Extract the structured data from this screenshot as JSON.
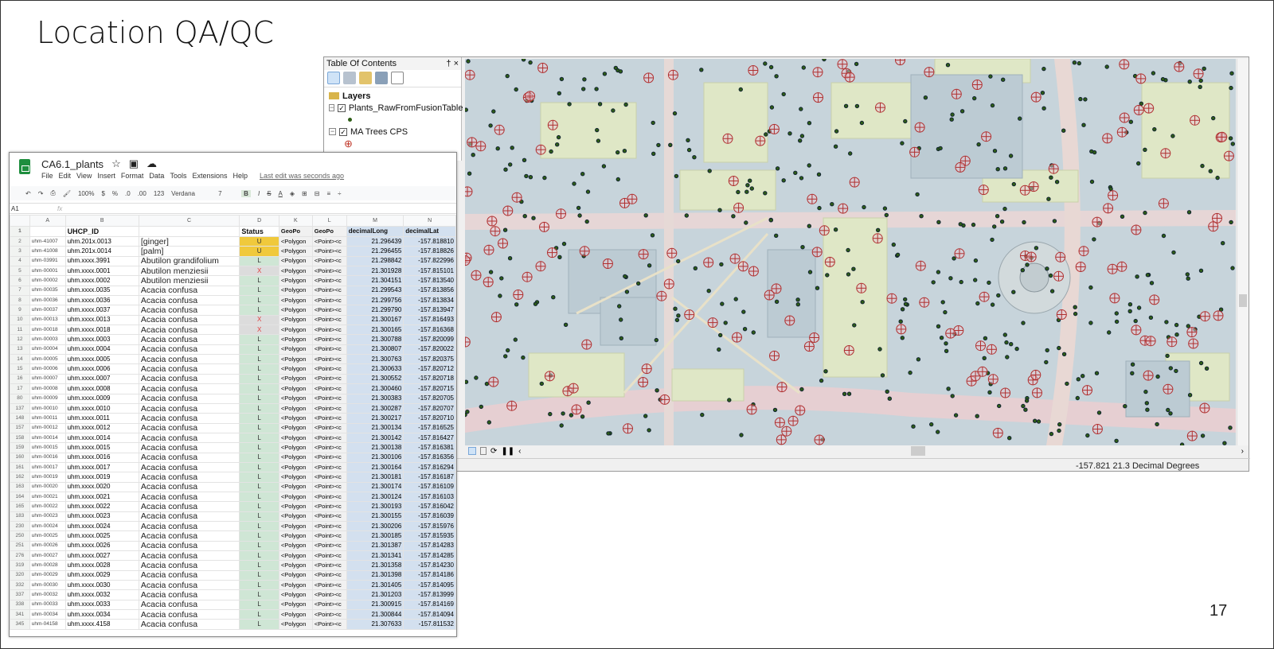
{
  "slide": {
    "title": "Location QA/QC",
    "page_number": "17"
  },
  "arcmap": {
    "toc": {
      "title": "Table Of Contents",
      "pin": "† ×",
      "root": "Layers",
      "layers": [
        {
          "name": "Plants_RawFromFusionTable",
          "checked": true,
          "symbol": "green-dot"
        },
        {
          "name": "MA Trees CPS",
          "checked": true,
          "symbol": "red-circle-cross"
        }
      ]
    },
    "status": {
      "coordinates": "-157.821  21.3 Decimal Degrees"
    },
    "colors": {
      "plant_dot": "#2e5d16",
      "tree_symbol": "#c0392b"
    }
  },
  "sheet": {
    "name": "CA6.1_plants",
    "menu": [
      "File",
      "Edit",
      "View",
      "Insert",
      "Format",
      "Data",
      "Tools",
      "Extensions",
      "Help"
    ],
    "last_edit": "Last edit was seconds ago",
    "toolbar": {
      "zoom": "100%",
      "currency": "$",
      "percent": "%",
      "dec_less": ".0",
      "dec_more": ".00",
      "format": "123",
      "font": "Verdana",
      "size": "7",
      "bold": "B",
      "italic": "I",
      "strike": "S",
      "color": "A"
    },
    "cell_ref": "A1",
    "fx": "fx",
    "columns": [
      "A",
      "B",
      "C",
      "D",
      "K",
      "L",
      "M",
      "N"
    ],
    "headers": [
      "",
      "UHCP_ID",
      "",
      "Status",
      "GeoPo",
      "GeoPo",
      "decimalLong",
      "decimalLat"
    ],
    "rows": [
      [
        "2",
        "uhm-41007",
        "uhm.201x.0013",
        "[ginger]",
        "U",
        "<Polygon",
        "<Point><c",
        "21.296439",
        "-157.818810"
      ],
      [
        "3",
        "uhm-41008",
        "uhm.201x.0014",
        "[palm]",
        "U",
        "<Polygon",
        "<Point><c",
        "21.296455",
        "-157.818826"
      ],
      [
        "4",
        "uhm-03991",
        "uhm.xxxx.3991",
        "Abutilon grandifolium",
        "L",
        "<Polygon",
        "<Point><c",
        "21.298842",
        "-157.822996"
      ],
      [
        "5",
        "uhm-00001",
        "uhm.xxxx.0001",
        "Abutilon menziesii",
        "X",
        "<Polygon",
        "<Point><c",
        "21.301928",
        "-157.815101"
      ],
      [
        "6",
        "uhm-00002",
        "uhm.xxxx.0002",
        "Abutilon menziesii",
        "L",
        "<Polygon",
        "<Point><c",
        "21.304151",
        "-157.813540"
      ],
      [
        "7",
        "uhm-00035",
        "uhm.xxxx.0035",
        "Acacia confusa",
        "L",
        "<Polygon",
        "<Point><c",
        "21.299543",
        "-157.813856"
      ],
      [
        "8",
        "uhm-00036",
        "uhm.xxxx.0036",
        "Acacia confusa",
        "L",
        "<Polygon",
        "<Point><c",
        "21.299756",
        "-157.813834"
      ],
      [
        "9",
        "uhm-00037",
        "uhm.xxxx.0037",
        "Acacia confusa",
        "L",
        "<Polygon",
        "<Point><c",
        "21.299790",
        "-157.813947"
      ],
      [
        "10",
        "uhm-00013",
        "uhm.xxxx.0013",
        "Acacia confusa",
        "X",
        "<Polygon",
        "<Point><c",
        "21.300167",
        "-157.816493"
      ],
      [
        "11",
        "uhm-00018",
        "uhm.xxxx.0018",
        "Acacia confusa",
        "X",
        "<Polygon",
        "<Point><c",
        "21.300165",
        "-157.816368"
      ],
      [
        "12",
        "uhm-00003",
        "uhm.xxxx.0003",
        "Acacia confusa",
        "L",
        "<Polygon",
        "<Point><c",
        "21.300788",
        "-157.820099"
      ],
      [
        "13",
        "uhm-00004",
        "uhm.xxxx.0004",
        "Acacia confusa",
        "L",
        "<Polygon",
        "<Point><c",
        "21.300807",
        "-157.820022"
      ],
      [
        "14",
        "uhm-00005",
        "uhm.xxxx.0005",
        "Acacia confusa",
        "L",
        "<Polygon",
        "<Point><c",
        "21.300763",
        "-157.820375"
      ],
      [
        "15",
        "uhm-00006",
        "uhm.xxxx.0006",
        "Acacia confusa",
        "L",
        "<Polygon",
        "<Point><c",
        "21.300633",
        "-157.820712"
      ],
      [
        "16",
        "uhm-00007",
        "uhm.xxxx.0007",
        "Acacia confusa",
        "L",
        "<Polygon",
        "<Point><c",
        "21.300552",
        "-157.820718"
      ],
      [
        "17",
        "uhm-00008",
        "uhm.xxxx.0008",
        "Acacia confusa",
        "L",
        "<Polygon",
        "<Point><c",
        "21.300460",
        "-157.820715"
      ],
      [
        "80",
        "uhm-00009",
        "uhm.xxxx.0009",
        "Acacia confusa",
        "L",
        "<Polygon",
        "<Point><c",
        "21.300383",
        "-157.820705"
      ],
      [
        "137",
        "uhm-00010",
        "uhm.xxxx.0010",
        "Acacia confusa",
        "L",
        "<Polygon",
        "<Point><c",
        "21.300287",
        "-157.820707"
      ],
      [
        "148",
        "uhm-00011",
        "uhm.xxxx.0011",
        "Acacia confusa",
        "L",
        "<Polygon",
        "<Point><c",
        "21.300217",
        "-157.820710"
      ],
      [
        "157",
        "uhm-00012",
        "uhm.xxxx.0012",
        "Acacia confusa",
        "L",
        "<Polygon",
        "<Point><c",
        "21.300134",
        "-157.816525"
      ],
      [
        "158",
        "uhm-00014",
        "uhm.xxxx.0014",
        "Acacia confusa",
        "L",
        "<Polygon",
        "<Point><c",
        "21.300142",
        "-157.816427"
      ],
      [
        "159",
        "uhm-00015",
        "uhm.xxxx.0015",
        "Acacia confusa",
        "L",
        "<Polygon",
        "<Point><c",
        "21.300138",
        "-157.816381"
      ],
      [
        "160",
        "uhm-00016",
        "uhm.xxxx.0016",
        "Acacia confusa",
        "L",
        "<Polygon",
        "<Point><c",
        "21.300106",
        "-157.816356"
      ],
      [
        "161",
        "uhm-00017",
        "uhm.xxxx.0017",
        "Acacia confusa",
        "L",
        "<Polygon",
        "<Point><c",
        "21.300164",
        "-157.816294"
      ],
      [
        "162",
        "uhm-00019",
        "uhm.xxxx.0019",
        "Acacia confusa",
        "L",
        "<Polygon",
        "<Point><c",
        "21.300181",
        "-157.816187"
      ],
      [
        "163",
        "uhm-00020",
        "uhm.xxxx.0020",
        "Acacia confusa",
        "L",
        "<Polygon",
        "<Point><c",
        "21.300174",
        "-157.816109"
      ],
      [
        "164",
        "uhm-00021",
        "uhm.xxxx.0021",
        "Acacia confusa",
        "L",
        "<Polygon",
        "<Point><c",
        "21.300124",
        "-157.816103"
      ],
      [
        "165",
        "uhm-00022",
        "uhm.xxxx.0022",
        "Acacia confusa",
        "L",
        "<Polygon",
        "<Point><c",
        "21.300193",
        "-157.816042"
      ],
      [
        "183",
        "uhm-00023",
        "uhm.xxxx.0023",
        "Acacia confusa",
        "L",
        "<Polygon",
        "<Point><c",
        "21.300155",
        "-157.816039"
      ],
      [
        "230",
        "uhm-00024",
        "uhm.xxxx.0024",
        "Acacia confusa",
        "L",
        "<Polygon",
        "<Point><c",
        "21.300206",
        "-157.815976"
      ],
      [
        "250",
        "uhm-00025",
        "uhm.xxxx.0025",
        "Acacia confusa",
        "L",
        "<Polygon",
        "<Point><c",
        "21.300185",
        "-157.815935"
      ],
      [
        "251",
        "uhm-00026",
        "uhm.xxxx.0026",
        "Acacia confusa",
        "L",
        "<Polygon",
        "<Point><c",
        "21.301387",
        "-157.814283"
      ],
      [
        "276",
        "uhm-00027",
        "uhm.xxxx.0027",
        "Acacia confusa",
        "L",
        "<Polygon",
        "<Point><c",
        "21.301341",
        "-157.814285"
      ],
      [
        "319",
        "uhm-00028",
        "uhm.xxxx.0028",
        "Acacia confusa",
        "L",
        "<Polygon",
        "<Point><c",
        "21.301358",
        "-157.814230"
      ],
      [
        "320",
        "uhm-00029",
        "uhm.xxxx.0029",
        "Acacia confusa",
        "L",
        "<Polygon",
        "<Point><c",
        "21.301398",
        "-157.814186"
      ],
      [
        "332",
        "uhm-00030",
        "uhm.xxxx.0030",
        "Acacia confusa",
        "L",
        "<Polygon",
        "<Point><c",
        "21.301405",
        "-157.814095"
      ],
      [
        "337",
        "uhm-00032",
        "uhm.xxxx.0032",
        "Acacia confusa",
        "L",
        "<Polygon",
        "<Point><c",
        "21.301203",
        "-157.813999"
      ],
      [
        "338",
        "uhm-00033",
        "uhm.xxxx.0033",
        "Acacia confusa",
        "L",
        "<Polygon",
        "<Point><c",
        "21.300915",
        "-157.814169"
      ],
      [
        "341",
        "uhm-00034",
        "uhm.xxxx.0034",
        "Acacia confusa",
        "L",
        "<Polygon",
        "<Point><c",
        "21.300844",
        "-157.814094"
      ],
      [
        "345",
        "uhm-04158",
        "uhm.xxxx.4158",
        "Acacia confusa",
        "L",
        "<Polygon",
        "<Point><c",
        "21.307633",
        "-157.811532"
      ]
    ]
  }
}
